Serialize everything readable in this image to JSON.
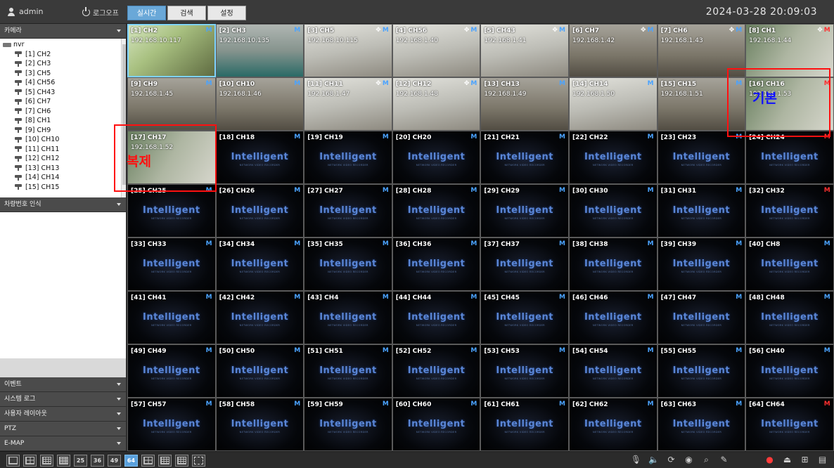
{
  "header": {
    "username": "admin",
    "logout_label": "로그오프",
    "tabs": [
      {
        "label": "실시간",
        "active": true
      },
      {
        "label": "검색",
        "active": false
      },
      {
        "label": "설정",
        "active": false
      }
    ],
    "datetime": "2024-03-28 20:09:03"
  },
  "sidebar": {
    "camera_section": "카메라",
    "root_label": "nvr",
    "channels": [
      "[1] CH2",
      "[2] CH3",
      "[3] CH5",
      "[4] CH56",
      "[5] CH43",
      "[6] CH7",
      "[7] CH6",
      "[8] CH1",
      "[9] CH9",
      "[10] CH10",
      "[11] CH11",
      "[12] CH12",
      "[13] CH13",
      "[14] CH14",
      "[15] CH15"
    ],
    "lpr_section": "차량번호 인식",
    "bottom_sections": [
      "이벤트",
      "시스템 로그",
      "사용자 레이아웃",
      "PTZ",
      "E-MAP"
    ]
  },
  "grid": {
    "logo_text": "Intelligent",
    "logo_subtext": "NETWORK VIDEO RECORDER",
    "tiles": [
      {
        "name": "[1] CH2",
        "ip": "192.168.10.117",
        "live": "g",
        "m": "blue",
        "selected": true
      },
      {
        "name": "[2] CH3",
        "ip": "192.168.10.135",
        "live": "t",
        "m": "blue"
      },
      {
        "name": "[3] CH5",
        "ip": "192.168.10.115",
        "live": "w",
        "m": "blue",
        "move": true
      },
      {
        "name": "[4] CH56",
        "ip": "192.168.1.40",
        "live": "w",
        "m": "blue",
        "move": true
      },
      {
        "name": "[5] CH43",
        "ip": "192.168.1.41",
        "live": "w",
        "m": "blue",
        "move": true
      },
      {
        "name": "[6] CH7",
        "ip": "192.168.1.42",
        "live": "d",
        "m": "blue",
        "move": true
      },
      {
        "name": "[7] CH6",
        "ip": "192.168.1.43",
        "live": "d",
        "m": "blue",
        "move": true
      },
      {
        "name": "[8] CH1",
        "ip": "192.168.1.44",
        "live": "p",
        "m": "red",
        "move": true
      },
      {
        "name": "[9] CH9",
        "ip": "192.168.1.45",
        "live": "d",
        "m": "blue"
      },
      {
        "name": "[10] CH10",
        "ip": "192.168.1.46",
        "live": "d",
        "m": "blue"
      },
      {
        "name": "[11] CH11",
        "ip": "192.168.1.47",
        "live": "w",
        "m": "blue",
        "move": true
      },
      {
        "name": "[12] CH12",
        "ip": "192.168.1.48",
        "live": "w",
        "m": "blue",
        "move": true
      },
      {
        "name": "[13] CH13",
        "ip": "192.168.1.49",
        "live": "d",
        "m": "blue"
      },
      {
        "name": "[14] CH14",
        "ip": "192.168.1.50",
        "live": "w",
        "m": "blue"
      },
      {
        "name": "[15] CH15",
        "ip": "192.168.1.51",
        "live": "d",
        "m": "blue"
      },
      {
        "name": "[16] CH16",
        "ip": "192.168.1.53",
        "live": "p",
        "m": "red"
      },
      {
        "name": "[17] CH17",
        "ip": "192.168.1.52",
        "live": "p",
        "m": ""
      },
      {
        "name": "[18] CH18",
        "m": "blue"
      },
      {
        "name": "[19] CH19",
        "m": "blue"
      },
      {
        "name": "[20] CH20",
        "m": "blue"
      },
      {
        "name": "[21] CH21",
        "m": "blue"
      },
      {
        "name": "[22] CH22",
        "m": "blue"
      },
      {
        "name": "[23] CH23",
        "m": "blue"
      },
      {
        "name": "[24] CH24",
        "m": "red"
      },
      {
        "name": "[25] CH25",
        "m": "blue"
      },
      {
        "name": "[26] CH26",
        "m": "blue"
      },
      {
        "name": "[27] CH27",
        "m": "blue"
      },
      {
        "name": "[28] CH28",
        "m": "blue"
      },
      {
        "name": "[29] CH29",
        "m": "blue"
      },
      {
        "name": "[30] CH30",
        "m": "blue"
      },
      {
        "name": "[31] CH31",
        "m": "blue"
      },
      {
        "name": "[32] CH32",
        "m": "red"
      },
      {
        "name": "[33] CH33",
        "m": "blue"
      },
      {
        "name": "[34] CH34",
        "m": "blue"
      },
      {
        "name": "[35] CH35",
        "m": "blue"
      },
      {
        "name": "[36] CH36",
        "m": "blue"
      },
      {
        "name": "[37] CH37",
        "m": "blue"
      },
      {
        "name": "[38] CH38",
        "m": "blue"
      },
      {
        "name": "[39] CH39",
        "m": "blue"
      },
      {
        "name": "[40] CH8",
        "m": "blue"
      },
      {
        "name": "[41] CH41",
        "m": "blue"
      },
      {
        "name": "[42] CH42",
        "m": "blue"
      },
      {
        "name": "[43] CH4",
        "m": "blue"
      },
      {
        "name": "[44] CH44",
        "m": "blue"
      },
      {
        "name": "[45] CH45",
        "m": "blue"
      },
      {
        "name": "[46] CH46",
        "m": "blue"
      },
      {
        "name": "[47] CH47",
        "m": "blue"
      },
      {
        "name": "[48] CH48",
        "m": "blue"
      },
      {
        "name": "[49] CH49",
        "m": "blue"
      },
      {
        "name": "[50] CH50",
        "m": "blue"
      },
      {
        "name": "[51] CH51",
        "m": "blue"
      },
      {
        "name": "[52] CH52",
        "m": "blue"
      },
      {
        "name": "[53] CH53",
        "m": "blue"
      },
      {
        "name": "[54] CH54",
        "m": "blue"
      },
      {
        "name": "[55] CH55",
        "m": "blue"
      },
      {
        "name": "[56] CH40",
        "m": "blue"
      },
      {
        "name": "[57] CH57",
        "m": "blue"
      },
      {
        "name": "[58] CH58",
        "m": "blue"
      },
      {
        "name": "[59] CH59",
        "m": "blue"
      },
      {
        "name": "[60] CH60",
        "m": "blue"
      },
      {
        "name": "[61] CH61",
        "m": "blue"
      },
      {
        "name": "[62] CH62",
        "m": "blue"
      },
      {
        "name": "[63] CH63",
        "m": "blue"
      },
      {
        "name": "[64] CH64",
        "m": "red"
      }
    ]
  },
  "annotations": {
    "left_text": "복제",
    "left_color": "#ff1010",
    "right_text": "기본",
    "right_color": "#1010ff"
  },
  "toolbar": {
    "layouts": [
      {
        "label": "",
        "icon": "layout-1-icon"
      },
      {
        "label": "",
        "icon": "layout-4-icon"
      },
      {
        "label": "",
        "icon": "layout-9-icon"
      },
      {
        "label": "",
        "icon": "layout-16-icon"
      },
      {
        "label": "25",
        "icon": ""
      },
      {
        "label": "36",
        "icon": ""
      },
      {
        "label": "49",
        "icon": ""
      },
      {
        "label": "64",
        "icon": "",
        "active": true
      },
      {
        "label": "",
        "icon": "layout-custom-a-icon"
      },
      {
        "label": "",
        "icon": "layout-custom-b-icon"
      },
      {
        "label": "",
        "icon": "layout-custom-c-icon"
      },
      {
        "label": "",
        "icon": "fullscreen-icon"
      }
    ],
    "tools": [
      "microphone-icon",
      "speaker-icon",
      "refresh-icon",
      "record-toggle-icon",
      "zoom-icon",
      "pen-icon",
      "rec-status-icon",
      "person-icon",
      "network-icon",
      "hdd-icon"
    ],
    "rec_label": "REC"
  }
}
